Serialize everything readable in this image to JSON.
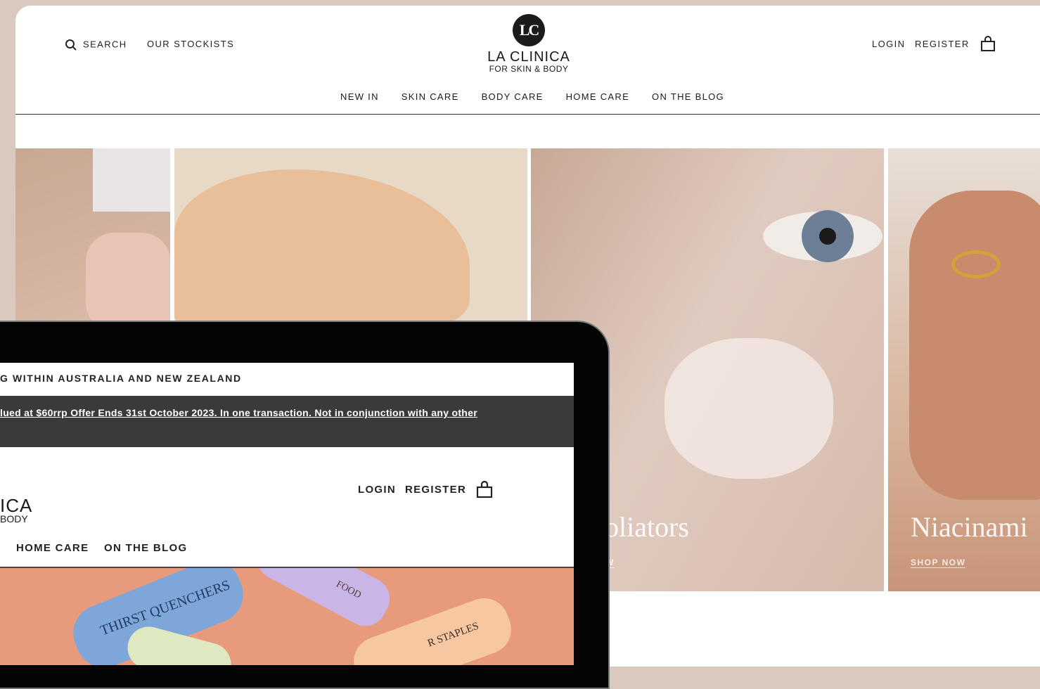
{
  "header": {
    "search_label": "SEARCH",
    "stockists_label": "OUR STOCKISTS",
    "login_label": "LOGIN",
    "register_label": "REGISTER"
  },
  "logo": {
    "mark": "LC",
    "name": "LA CLINICA",
    "tagline": "FOR SKIN & BODY"
  },
  "nav": [
    "NEW IN",
    "SKIN CARE",
    "BODY CARE",
    "HOME CARE",
    "ON THE BLOG"
  ],
  "tiles": [
    {
      "caption": "",
      "shop": ""
    },
    {
      "caption": "",
      "shop": ""
    },
    {
      "caption": "oliators",
      "shop": "W"
    },
    {
      "caption": "Niacinami",
      "shop": "SHOP NOW"
    }
  ],
  "tablet": {
    "shipping": "G WITHIN AUSTRALIA AND NEW ZEALAND",
    "promo": "lued at $60rrp Offer Ends 31st October 2023. In one transaction. Not in conjunction with any other",
    "logo_name": "ICA",
    "logo_sub": "BODY",
    "login_label": "LOGIN",
    "register_label": "REGISTER",
    "nav": [
      "HOME CARE",
      "ON THE BLOG"
    ],
    "products": [
      "THIRST QUENCHERS",
      "FOOD",
      "R STAPLES"
    ]
  },
  "colors": {
    "page_bg": "#d9c9bf",
    "promo_bg": "#3a3a3a",
    "hero_bg": "#e79b7c"
  },
  "icons": [
    "search-icon",
    "bag-icon"
  ]
}
